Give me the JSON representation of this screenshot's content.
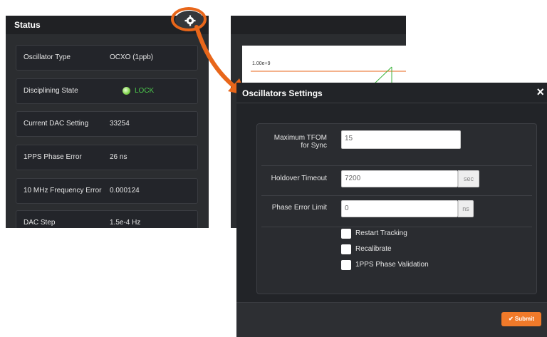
{
  "status": {
    "title": "Status",
    "rows": [
      {
        "label": "Oscillator Type",
        "value": "OCXO (1ppb)"
      },
      {
        "label": "Disciplining State",
        "value": "LOCK"
      },
      {
        "label": "Current DAC Setting",
        "value": "33254"
      },
      {
        "label": "1PPS Phase Error",
        "value": "26 ns"
      },
      {
        "label": "10 MHz Frequency Error",
        "value": "0.000124"
      },
      {
        "label": "DAC Step",
        "value": "1.5e-4 Hz"
      }
    ]
  },
  "chart": {
    "y_tick": "1.00e+9"
  },
  "modal": {
    "title": "Oscillators Settings",
    "close": "×",
    "fields": {
      "tfom_label_line1": "Maximum TFOM",
      "tfom_label_line2": "for Sync",
      "tfom_value": "15",
      "holdover_label": "Holdover Timeout",
      "holdover_value": "7200",
      "holdover_unit": "sec",
      "phase_label": "Phase Error Limit",
      "phase_value": "0",
      "phase_unit": "ns"
    },
    "checkboxes": [
      "Restart Tracking",
      "Recalibrate",
      "1PPS Phase Validation"
    ],
    "submit_label": "✔ Submit"
  },
  "colors": {
    "accent": "#e8661a",
    "lock": "#4cc94c",
    "submit": "#f07a2a"
  }
}
